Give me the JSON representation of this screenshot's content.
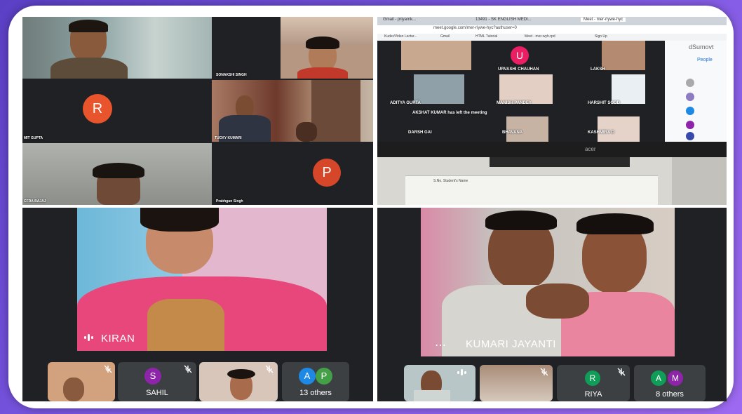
{
  "top_left": {
    "participants": [
      {
        "name": "SONAKSHI SINGH"
      },
      {
        "name": "MIT GUPTA",
        "initial": "R"
      },
      {
        "name": "TUCKY KUMARI"
      },
      {
        "name": "CFRA BAJAJ"
      },
      {
        "name": "Prabhgun Singh",
        "initial": "P"
      }
    ]
  },
  "top_right": {
    "tabs": [
      "Gmail - priyamk...",
      "13491 - SK ENGLISH MEDI...",
      "Meet - mer-riywe-hyc"
    ],
    "url": "meet.google.com/mer-riywe-hyc?authuser=0",
    "bookmarks": [
      "Kuder/Video Lectur...",
      "Gmail",
      "HTML Tutorial",
      "Meet - mer-wyh-rpd",
      "Sign Up"
    ],
    "participant_u": {
      "initial": "U",
      "name": "URVASHI CHAUHAN"
    },
    "labels": [
      "LAKSH",
      "ADITYA GUPTA",
      "MANISH PANDEY",
      "HARSHIT SOOD",
      "DARSH GAI",
      "BHAVANA",
      "KASHMIRA D"
    ],
    "notice": "AKSHAT KUMAR has left the meeting",
    "side_title": "dSumovt",
    "people_label": "People",
    "monitor_brand": "acer",
    "sheet_header": "S.No.  Student's Name"
  },
  "bottom_left": {
    "main_name": "KIRAN",
    "strip": [
      {
        "kind": "video"
      },
      {
        "initial": "S",
        "name": "SAHIL"
      },
      {
        "kind": "video"
      },
      {
        "initials": [
          "A",
          "P"
        ],
        "name": "13 others"
      }
    ]
  },
  "bottom_right": {
    "main_name": "KUMARI JAYANTI",
    "strip": [
      {
        "kind": "video"
      },
      {
        "kind": "video"
      },
      {
        "initial": "R",
        "name": "RIYA"
      },
      {
        "initials": [
          "A",
          "M"
        ],
        "name": "8 others"
      }
    ]
  },
  "colors": {
    "meet_dark": "#202124",
    "avatar_r": "#e8542c",
    "avatar_p": "#d6472a",
    "avatar_s": "#8e24aa",
    "avatar_a": "#1e88e5",
    "avatar_p2": "#43a047",
    "avatar_r2": "#0f9d58",
    "avatar_m": "#8e24aa",
    "avatar_u": "#e91e63"
  }
}
